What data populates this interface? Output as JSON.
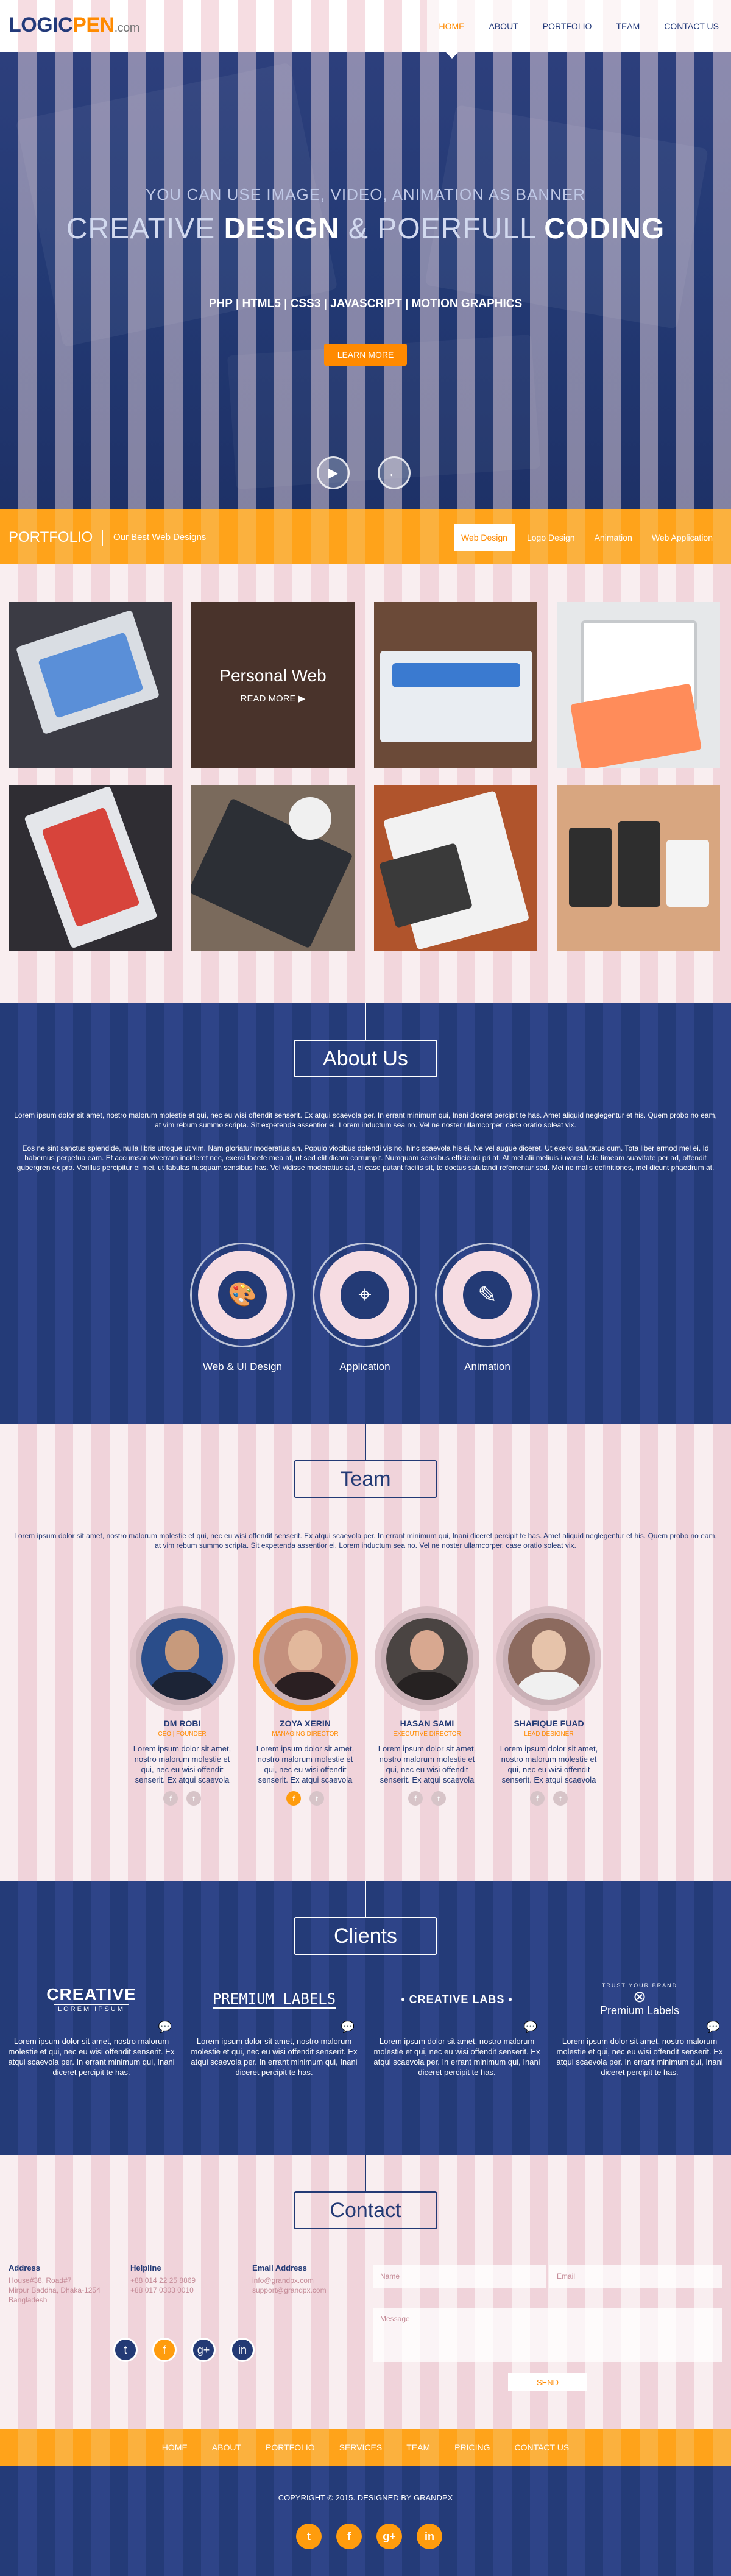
{
  "header": {
    "logo_main": "LOGIC",
    "logo_accent": "PEN",
    "logo_suffix": ".com",
    "nav": [
      "HOME",
      "ABOUT",
      "PORTFOLIO",
      "TEAM",
      "CONTACT US"
    ]
  },
  "hero": {
    "subtitle": "YOU CAN USE IMAGE, VIDEO, ANIMATION AS BANNER",
    "title_1": "CREATIVE ",
    "title_2": "DESIGN",
    "title_3": " & POERFULL ",
    "title_4": "CODING",
    "tags": "PHP | HTML5 | CSS3 | JAVASCRIPT | MOTION GRAPHICS",
    "button": "LEARN MORE"
  },
  "portfolio": {
    "title": "PORTFOLIO",
    "subtitle": "Our Best Web Designs",
    "filters": [
      "Web Design",
      "Logo Design",
      "Animation",
      "Web Application"
    ],
    "hover_title": "Personal Web",
    "hover_link": "READ MORE"
  },
  "about": {
    "title": "About Us",
    "para1": "Lorem ipsum dolor sit amet, nostro malorum molestie et qui, nec eu wisi offendit senserit. Ex atqui scaevola per. In errant minimum qui, Inani diceret percipit te has. Amet aliquid neglegentur et his. Quem probo no eam, at vim rebum summo scripta. Sit expetenda assentior ei. Lorem inductum sea no. Vel ne noster ullamcorper, case oratio soleat vix.",
    "para2": "Eos ne sint sanctus splendide, nulla libris utroque ut vim. Nam gloriatur moderatius an. Populo viocibus dolendi vis no, hinc scaevola his ei. Ne vel augue diceret. Ut exerci salutatus cum. Tota liber ermod mel ei. Id habemus perpetua eam. Et accumsan viverram incideret nec, exerci facete mea at, ut sed elit dicam corrumpit. Numquam sensibus efficiendi pri at. At mel alii meliuis iuvaret, tale timeam suavitate per ad, offendit gubergren ex pro. Verillus percipitur ei mei, ut fabulas nusquam sensibus has. Vel vidisse moderatius ad, ei case putant facilis sit, te doctus salutandi referrentur sed. Mei no malis definitiones, mel dicunt phaedrum at.",
    "services": [
      "Web & UI Design",
      "Application",
      "Animation"
    ]
  },
  "team": {
    "title": "Team",
    "para": "Lorem ipsum dolor sit amet, nostro malorum molestie et qui, nec eu wisi offendit senserit. Ex atqui scaevola per. In errant minimum qui, Inani diceret percipit te has. Amet aliquid neglegentur et his. Quem probo no eam, at vim rebum summo scripta. Sit expetenda assentior ei. Lorem inductum sea no. Vel ne noster ullamcorper, case oratio soleat vix.",
    "members": [
      {
        "name": "DM ROBI",
        "role": "CEO | FOUNDER",
        "text": "Lorem ipsum dolor sit amet, nostro malorum molestie et qui, nec eu wisi offendit senserit. Ex atqui scaevola"
      },
      {
        "name": "ZOYA XERIN",
        "role": "MANAGING DIRECTOR",
        "text": "Lorem ipsum dolor sit amet, nostro malorum molestie et qui, nec eu wisi offendit senserit. Ex atqui scaevola"
      },
      {
        "name": "HASAN SAMI",
        "role": "EXECUTIVE DIRECTOR",
        "text": "Lorem ipsum dolor sit amet, nostro malorum molestie et qui, nec eu wisi offendit senserit. Ex atqui scaevola"
      },
      {
        "name": "SHAFIQUE FUAD",
        "role": "LEAD DESIGNER",
        "text": "Lorem ipsum dolor sit amet, nostro malorum molestie et qui, nec eu wisi offendit senserit. Ex atqui scaevola"
      }
    ]
  },
  "clients": {
    "title": "Clients",
    "logos": [
      {
        "line1": "CREATIVE",
        "line2": "LOREM IPSUM"
      },
      {
        "line1": "PREMIUM LABELS",
        "line2": ""
      },
      {
        "line1": "• CREATIVE LABS •",
        "line2": ""
      },
      {
        "line1": "TRUST YOUR BRAND",
        "line2": "Premium Labels"
      }
    ],
    "text": "Lorem ipsum dolor sit amet, nostro malorum molestie et qui, nec eu wisi offendit senserit. Ex atqui scaevola per. In errant minimum qui, Inani diceret percipit te has."
  },
  "contact": {
    "title": "Contact",
    "address_label": "Address",
    "address": [
      "House#38, Road#7",
      "Mirpur Baddha, Dhaka-1254",
      "Bangladesh"
    ],
    "helpline_label": "Helpline",
    "helpline": [
      "+88 014 22 25 8869",
      "+88 017 0303 0010"
    ],
    "email_label": "Email Address",
    "email": [
      "info@grandpx.com",
      "support@grandpx.com"
    ],
    "name_placeholder": "Name",
    "email_placeholder": "Email",
    "message_placeholder": "Message",
    "send": "SEND"
  },
  "footer": {
    "nav": [
      "HOME",
      "ABOUT",
      "PORTFOLIO",
      "SERVICES",
      "TEAM",
      "PRICING",
      "CONTACT US"
    ],
    "copyright": "COPYRIGHT © 2015. DESIGNED BY GRANDPX"
  }
}
